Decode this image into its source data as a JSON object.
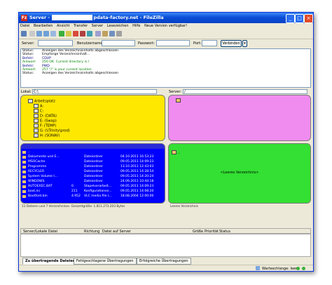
{
  "window": {
    "title_prefix": "Server - ",
    "title_suffix": "pdata-factory.net - FileZilla",
    "app_icon": "Fz"
  },
  "menu": [
    "Datei",
    "Bearbeiten",
    "Ansicht",
    "Transfer",
    "Server",
    "Lesezeichen",
    "Hilfe",
    "Neue Version verfügbar!"
  ],
  "connection": {
    "server_label": "Server:",
    "user_label": "Benutzername:",
    "password_label": "Passwort:",
    "port_label": "Port:",
    "connect_label": "Verbinden",
    "dropdown_arrow": "▾"
  },
  "log": [
    {
      "key": "Status:",
      "text": "Anzeigen des Verzeichnisinhalts abgeschlossen",
      "kind": "status"
    },
    {
      "key": "Status:",
      "text": "Empfange Verzeichnisinhalt...",
      "kind": "status"
    },
    {
      "key": "Befehl:",
      "text": "CDUP",
      "kind": "cmd"
    },
    {
      "key": "Antwort:",
      "text": "250 OK. Current directory is /",
      "kind": "resp"
    },
    {
      "key": "Befehl:",
      "text": "PWD",
      "kind": "cmd"
    },
    {
      "key": "Antwort:",
      "text": "257 \"/\" is your current location",
      "kind": "resp"
    },
    {
      "key": "Status:",
      "text": "Anzeigen des Verzeichnisinhalts abgeschlossen",
      "kind": "status"
    }
  ],
  "local_site": {
    "label": "Lokal:",
    "value": "C:\\"
  },
  "remote_site": {
    "label": "Server:",
    "value": "/"
  },
  "local_tree": [
    {
      "label": "Arbeitsplatz",
      "level": 1
    },
    {
      "label": "A:",
      "level": 2
    },
    {
      "label": "C:",
      "level": 2
    },
    {
      "label": "D: (DATA)",
      "level": 2
    },
    {
      "label": "E: (Swap)",
      "level": 2
    },
    {
      "label": "F: (TEMP)",
      "level": 2
    },
    {
      "label": "G: (\\\\Trinity\\prod)",
      "level": 2
    },
    {
      "label": "H: (SONAV)",
      "level": 2
    }
  ],
  "local_files": [
    {
      "name": "..",
      "size": "",
      "type": "",
      "date": ""
    },
    {
      "name": "Dokumente und E...",
      "size": "",
      "type": "Dateiordner",
      "date": "04.10.2011 16:53:23"
    },
    {
      "name": "MSOCache",
      "size": "",
      "type": "Dateiordner",
      "date": "09.05.2011 14:09:23"
    },
    {
      "name": "Programme",
      "size": "",
      "type": "Dateiordner",
      "date": "13.10.2011 12:43:03"
    },
    {
      "name": "RECYCLER",
      "size": "",
      "type": "Dateiordner",
      "date": "09.05.2011 14:28:54"
    },
    {
      "name": "System Volume I...",
      "size": "",
      "type": "Dateiordner",
      "date": "09.05.2011 14:20:24"
    },
    {
      "name": "WINDOWS",
      "size": "",
      "type": "Dateiordner",
      "date": "24.09.2011 10:44:18"
    },
    {
      "name": "AUTOEXEC.BAT",
      "size": "0",
      "type": "Stapelverarbeit...",
      "date": "09.05.2011 14:09:23"
    },
    {
      "name": "boot.ini",
      "size": "211",
      "type": "Konfigurationse...",
      "date": "09.05.2011 14:08:20"
    },
    {
      "name": "Bootfont.bin",
      "size": "4.952",
      "type": "VLC media file (...",
      "date": "18.08.2004 12:00:00"
    }
  ],
  "local_summary": "11 Dateien und 7 Verzeichnisse. Gesamtgröße: 1.811.273.203 Bytes",
  "remote_files": [
    {
      "name": ".."
    }
  ],
  "remote_empty": "<Leeres Verzeichnis>",
  "remote_summary": "Leeres Verzeichnis",
  "queue_columns": [
    "Server/Lokale Datei",
    "Richtung",
    "Datei auf Server",
    "Größe",
    "Priorität",
    "Status"
  ],
  "tabs": [
    "Zu übertragende Dateien",
    "Fehlgeschlagene Übertragungen",
    "Erfolgreiche Übertragungen"
  ],
  "statusbar": {
    "queue": "Warteschlange: leer"
  },
  "colors": {
    "yellow": "#ffe800",
    "magenta": "#f08cf0",
    "blue": "#0000ff",
    "green": "#33e033",
    "titlebar": "#0a4ed8"
  }
}
